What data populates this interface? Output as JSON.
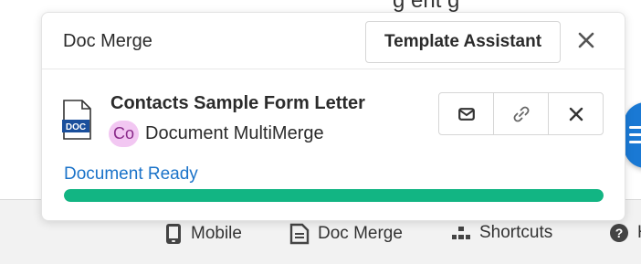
{
  "background": {
    "peek_text": "g ent g"
  },
  "bottom_bar": {
    "items": [
      {
        "label": "Mobile",
        "icon": "mobile-icon"
      },
      {
        "label": "Doc Merge",
        "icon": "doc-merge-icon"
      },
      {
        "label": "Shortcuts",
        "icon": "shortcuts-icon"
      },
      {
        "label": "H",
        "icon": "help-icon"
      }
    ]
  },
  "panel": {
    "title": "Doc Merge",
    "template_button": "Template Assistant",
    "close_icon": "close-icon",
    "document": {
      "icon_label": "DOC",
      "name": "Contacts Sample Form Letter",
      "avatar_initials": "Co",
      "type": "Document MultiMerge",
      "actions": [
        "email-icon",
        "link-icon",
        "delete-icon"
      ]
    },
    "status": "Document Ready",
    "progress": 1.0,
    "colors": {
      "accent_blue": "#1b73c9",
      "progress_green": "#12b583",
      "avatar_bg": "#f2c7f2"
    }
  }
}
